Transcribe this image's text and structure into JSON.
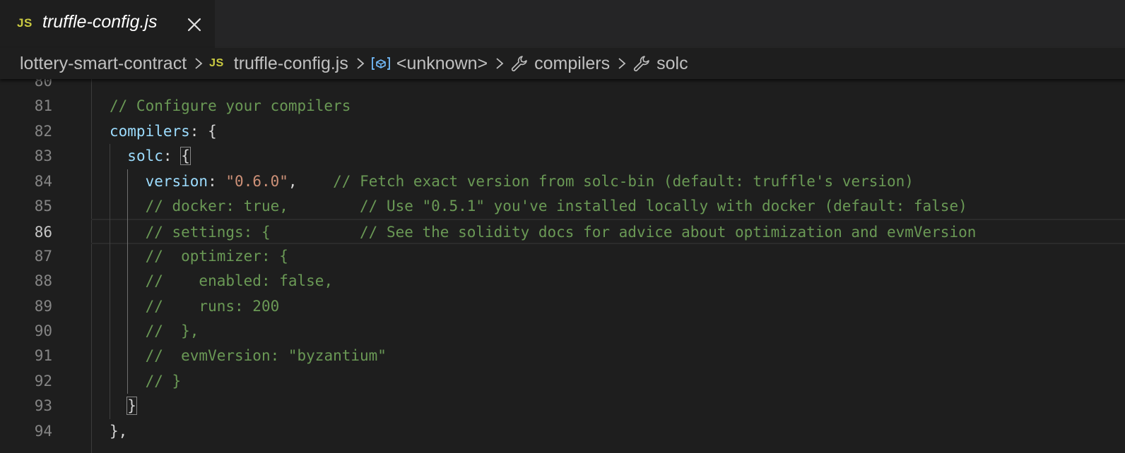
{
  "tab": {
    "badge": "JS",
    "title": "truffle-config.js"
  },
  "breadcrumb": {
    "items": [
      {
        "label": "lottery-smart-contract",
        "icon": ""
      },
      {
        "label": "truffle-config.js",
        "icon": "js-file-icon",
        "badge": "JS"
      },
      {
        "label": "<unknown>",
        "icon": "variable-icon"
      },
      {
        "label": "compilers",
        "icon": "wrench-icon"
      },
      {
        "label": "solc",
        "icon": "wrench-icon"
      }
    ]
  },
  "editor": {
    "current_line": 86,
    "lines": [
      {
        "n": "80",
        "code": ""
      },
      {
        "n": "81",
        "code": "// Configure your compilers"
      },
      {
        "n": "82",
        "code": "compilers: {"
      },
      {
        "n": "83",
        "code": "  solc: {"
      },
      {
        "n": "84",
        "code": "    version: \"0.6.0\",    // Fetch exact version from solc-bin (default: truffle's version)"
      },
      {
        "n": "85",
        "code": "    // docker: true,        // Use \"0.5.1\" you've installed locally with docker (default: false)"
      },
      {
        "n": "86",
        "code": "    // settings: {          // See the solidity docs for advice about optimization and evmVersion"
      },
      {
        "n": "87",
        "code": "    //  optimizer: {"
      },
      {
        "n": "88",
        "code": "    //    enabled: false,"
      },
      {
        "n": "89",
        "code": "    //    runs: 200"
      },
      {
        "n": "90",
        "code": "    //  },"
      },
      {
        "n": "91",
        "code": "    //  evmVersion: \"byzantium\""
      },
      {
        "n": "92",
        "code": "    // }"
      },
      {
        "n": "93",
        "code": "  }"
      },
      {
        "n": "94",
        "code": "},"
      }
    ]
  },
  "colors": {
    "comment": "#6a9955",
    "key": "#9cdcfe",
    "string": "#ce9178",
    "js_badge": "#cbcb41"
  }
}
